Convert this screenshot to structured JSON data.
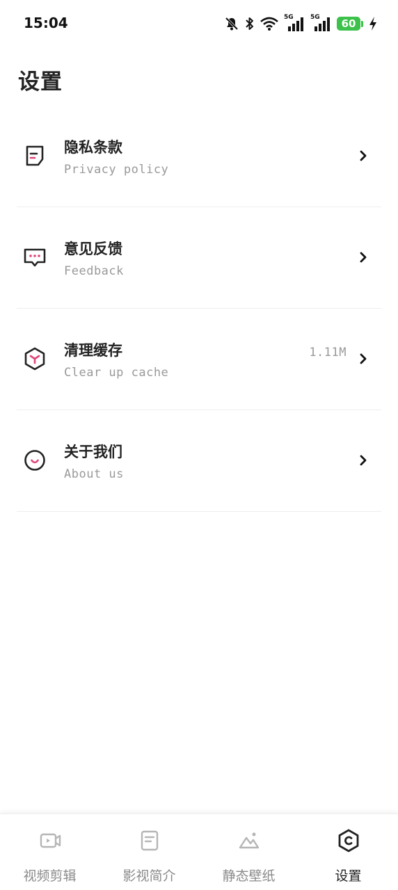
{
  "status_bar": {
    "time": "15:04",
    "battery_level": "60",
    "signal_1_label": "5G",
    "signal_2_label": "5G",
    "icons": [
      "mute-bell-icon",
      "bluetooth-icon",
      "wifi-icon",
      "signal-5g-icon",
      "signal-5g-icon",
      "battery-icon",
      "charging-bolt-icon"
    ]
  },
  "page": {
    "title": "设置"
  },
  "settings": {
    "items": [
      {
        "title": "隐私条款",
        "subtitle": "Privacy policy",
        "value": "",
        "icon": "document-icon"
      },
      {
        "title": "意见反馈",
        "subtitle": "Feedback",
        "value": "",
        "icon": "chat-bubble-icon"
      },
      {
        "title": "清理缓存",
        "subtitle": "Clear up cache",
        "value": "1.11M",
        "icon": "box-icon"
      },
      {
        "title": "关于我们",
        "subtitle": "About us",
        "value": "",
        "icon": "smile-icon"
      }
    ]
  },
  "tabbar": {
    "tabs": [
      {
        "label": "视频剪辑",
        "icon": "video-edit-icon",
        "active": false
      },
      {
        "label": "影视简介",
        "icon": "film-info-icon",
        "active": false
      },
      {
        "label": "静态壁纸",
        "icon": "wallpaper-icon",
        "active": false
      },
      {
        "label": "设置",
        "icon": "settings-hex-icon",
        "active": true
      }
    ]
  },
  "colors": {
    "accent": "#e0447a",
    "battery": "#3cc14a",
    "text_primary": "#222222",
    "text_secondary": "#999999"
  }
}
